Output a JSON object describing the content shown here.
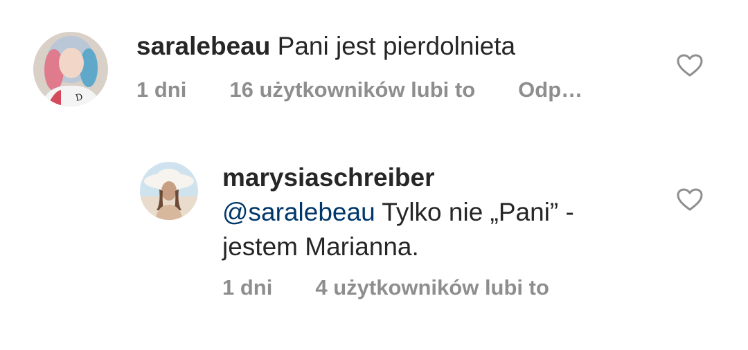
{
  "comments": [
    {
      "username": "saralebeau",
      "text": "Pani jest pierdolnieta",
      "time": "1 dni",
      "likes": "16 użytkowników lubi to",
      "reply": "Odp…",
      "like_icon": "heart-outline-icon"
    },
    {
      "username": "marysiaschreiber",
      "mention": "@saralebeau",
      "text_line1": " Tylko nie „Pani” -",
      "text_line2": "jestem Marianna.",
      "time": "1 dni",
      "likes": "4 użytkowników lubi to",
      "like_icon": "heart-outline-icon"
    }
  ]
}
